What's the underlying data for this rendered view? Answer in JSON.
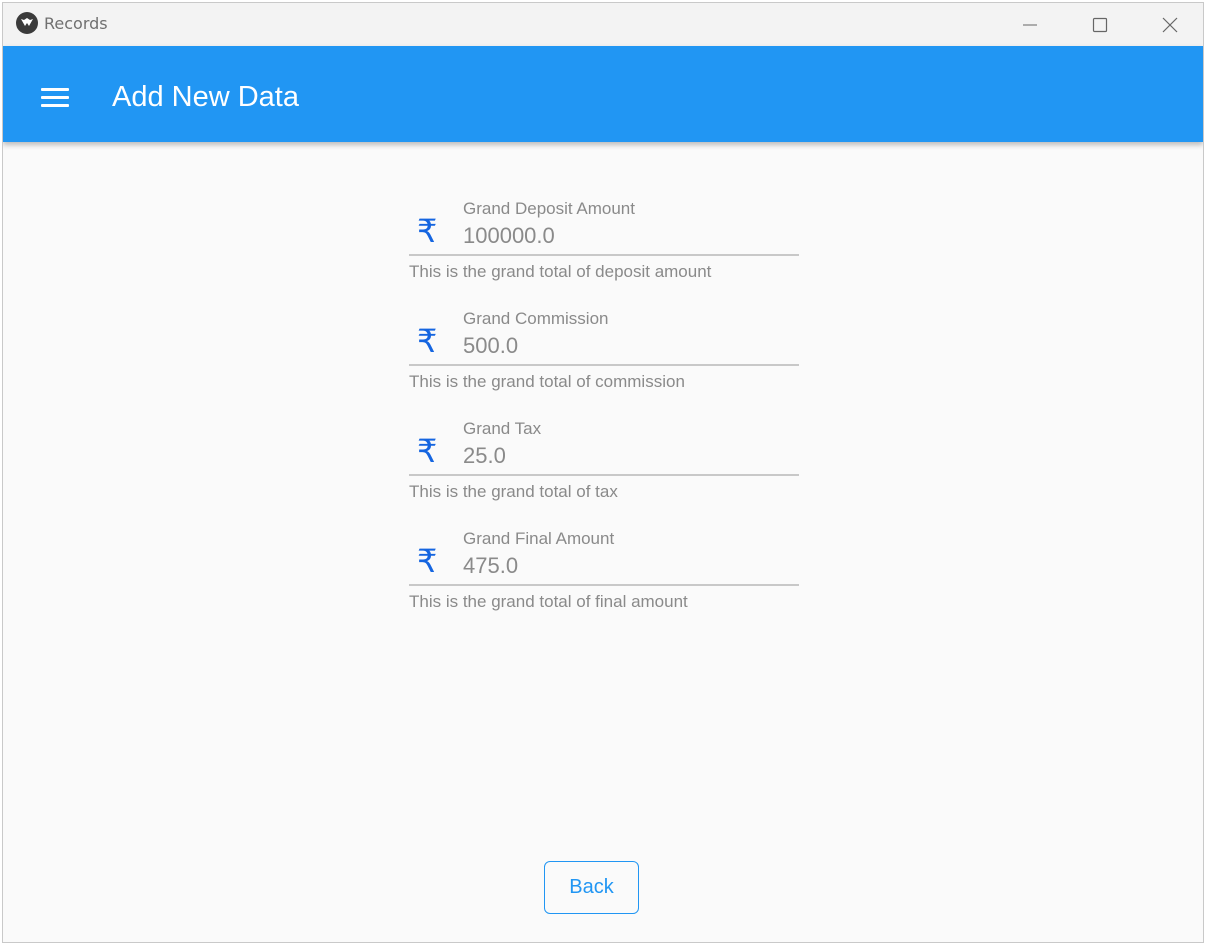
{
  "window": {
    "title": "Records"
  },
  "appbar": {
    "title": "Add New Data",
    "menu_icon": "hamburger-menu-icon"
  },
  "fields": [
    {
      "label": "Grand Deposit Amount",
      "value": "100000.0",
      "helper": "This is the grand total of deposit amount",
      "icon": "rupee-icon"
    },
    {
      "label": "Grand Commission",
      "value": "500.0",
      "helper": "This is the grand total of commission",
      "icon": "rupee-icon"
    },
    {
      "label": "Grand Tax",
      "value": "25.0",
      "helper": "This is the grand total of tax",
      "icon": "rupee-icon"
    },
    {
      "label": "Grand Final Amount",
      "value": "475.0",
      "helper": "This is the grand total of final amount",
      "icon": "rupee-icon"
    }
  ],
  "rupee_symbol": "₹",
  "back_button": {
    "label": "Back"
  },
  "colors": {
    "primary": "#2196f3",
    "icon": "#1565e0",
    "text_muted": "#8a8a8a"
  }
}
